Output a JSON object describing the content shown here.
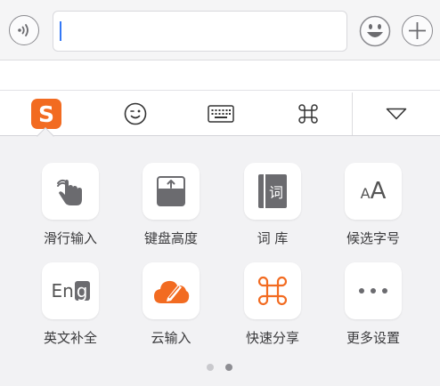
{
  "chat_bar": {
    "voice_icon": "voice-wave-icon",
    "input_value": "",
    "emoji_icon": "smiley-face-icon",
    "plus_icon": "plus-icon"
  },
  "toolbar": {
    "tabs": [
      {
        "id": "sogou",
        "icon": "sogou-logo-icon",
        "text": "S",
        "active": true
      },
      {
        "id": "emoji",
        "icon": "wink-face-icon"
      },
      {
        "id": "keyboard",
        "icon": "keyboard-icon"
      },
      {
        "id": "command",
        "icon": "command-key-icon"
      },
      {
        "id": "collapse",
        "icon": "triangle-down-icon"
      }
    ]
  },
  "grid": {
    "items": [
      {
        "label": "滑行输入",
        "icon": "swipe-hand-icon"
      },
      {
        "label": "键盘高度",
        "icon": "keyboard-height-icon"
      },
      {
        "label": "词 库",
        "icon": "dictionary-book-icon",
        "icon_text": "词"
      },
      {
        "label": "候选字号",
        "icon": "font-size-icon",
        "icon_text_small": "A",
        "icon_text_big": "A"
      },
      {
        "label": "英文补全",
        "icon": "english-complete-icon",
        "icon_text": "En",
        "icon_text_highlight": "g"
      },
      {
        "label": "云输入",
        "icon": "cloud-pen-icon"
      },
      {
        "label": "快速分享",
        "icon": "command-share-icon"
      },
      {
        "label": "更多设置",
        "icon": "more-dots-icon"
      }
    ]
  },
  "pagination": {
    "pages": 2,
    "current": 2
  },
  "colors": {
    "brand_orange": "#f26b21",
    "icon_gray": "#6b6b6f",
    "caret_blue": "#3478f6"
  }
}
